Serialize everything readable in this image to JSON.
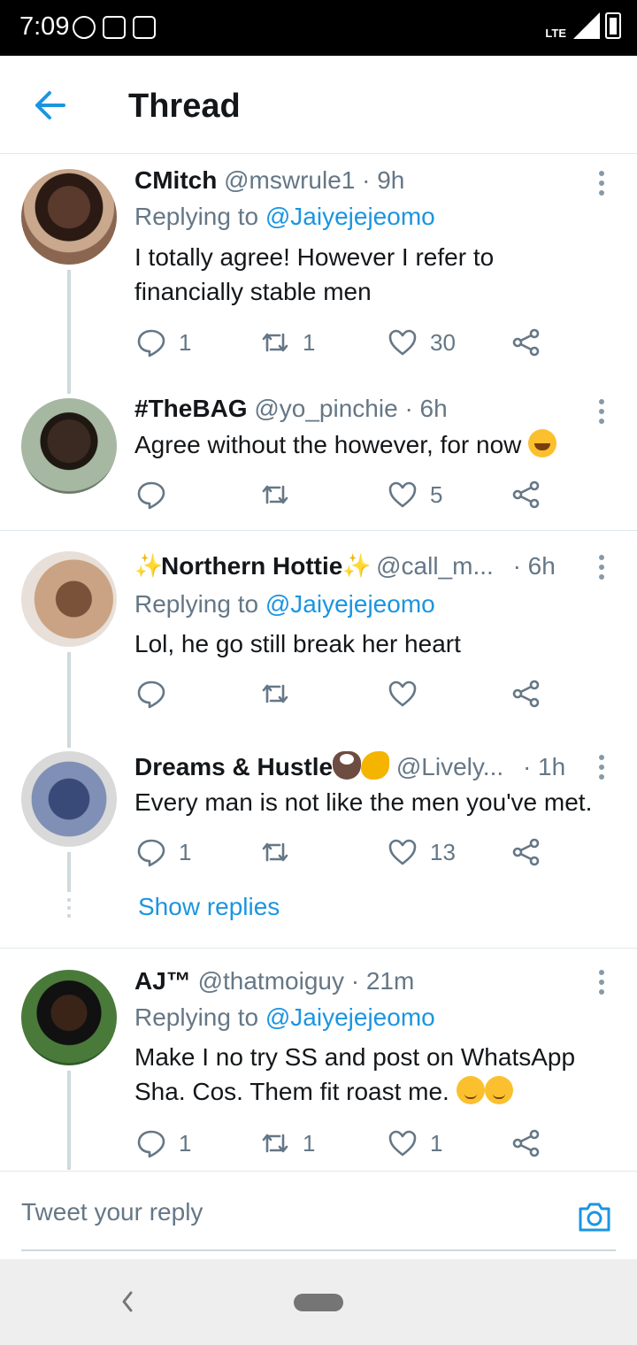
{
  "status_bar": {
    "time": "7:09",
    "network": "LTE"
  },
  "header": {
    "title": "Thread"
  },
  "tweets": [
    {
      "name": "CMitch",
      "handle": "@mswrule1",
      "time": "· 9h",
      "replying_label": "Replying to ",
      "replying_to": "@Jaiyejejeomo",
      "text": "I totally agree! However I refer to financially stable men",
      "replies": "1",
      "retweets": "1",
      "likes": "30"
    },
    {
      "name": "#TheBAG",
      "handle": "@yo_pinchie",
      "time": "· 6h",
      "text": "Agree without the however, for now",
      "replies": "",
      "retweets": "",
      "likes": "5"
    },
    {
      "name": "Northern Hottie",
      "handle": "@call_m...",
      "time": "· 6h",
      "replying_label": "Replying to ",
      "replying_to": "@Jaiyejejeomo",
      "text": "Lol, he go still break her heart",
      "replies": "",
      "retweets": "",
      "likes": ""
    },
    {
      "name": "Dreams & Hustle",
      "handle": "@Lively...",
      "time": "· 1h",
      "text": "Every man is not like the men you've met.",
      "replies": "1",
      "retweets": "",
      "likes": "13",
      "show_replies": "Show replies"
    },
    {
      "name": "AJ™",
      "handle": "@thatmoiguy",
      "time": "· 21m",
      "replying_label": "Replying to ",
      "replying_to": "@Jaiyejejeomo",
      "text": "Make I no try SS and post on WhatsApp Sha. Cos. Them fit roast me.",
      "replies": "1",
      "retweets": "1",
      "likes": "1"
    }
  ],
  "reply_bar": {
    "placeholder": "Tweet your reply"
  },
  "icons": {
    "accent": "#1b95e0",
    "action_gray": "#657786"
  }
}
